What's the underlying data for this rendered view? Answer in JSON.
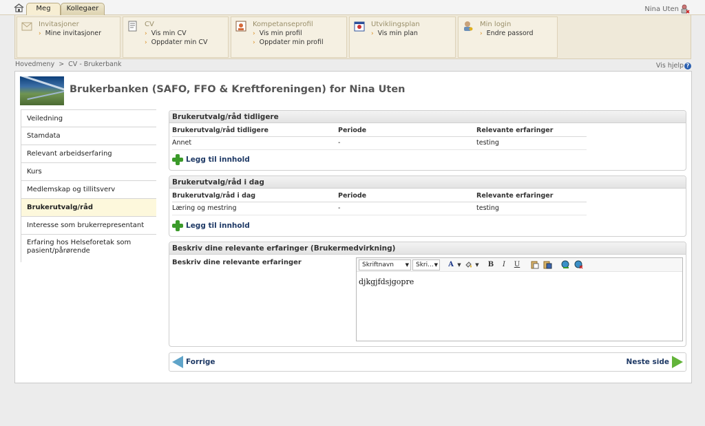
{
  "topbar": {
    "tabs": [
      {
        "label": "Meg"
      },
      {
        "label": "Kollegaer"
      }
    ],
    "user_name": "Nina Uten"
  },
  "menu": {
    "groups": [
      {
        "title": "Invitasjoner",
        "icon": "invitation-icon",
        "links": [
          "Mine invitasjoner"
        ]
      },
      {
        "title": "CV",
        "icon": "cv-document-icon",
        "links": [
          "Vis min CV",
          "Oppdater min CV"
        ]
      },
      {
        "title": "Kompetanseprofil",
        "icon": "profile-card-icon",
        "links": [
          "Vis min profil",
          "Oppdater min profil"
        ]
      },
      {
        "title": "Utviklingsplan",
        "icon": "plan-calendar-icon",
        "links": [
          "Vis min plan"
        ]
      },
      {
        "title": "Min login",
        "icon": "user-key-icon",
        "links": [
          "Endre passord"
        ]
      }
    ]
  },
  "breadcrumb": {
    "items": [
      "Hovedmeny",
      "CV - Brukerbank"
    ],
    "separator": ">"
  },
  "help": {
    "label": "Vis hjelp",
    "icon": "help-icon"
  },
  "page": {
    "title": "Brukerbanken (SAFO, FFO & Kreftforeningen) for Nina Uten"
  },
  "sidebar": {
    "items": [
      {
        "label": "Veiledning"
      },
      {
        "label": "Stamdata"
      },
      {
        "label": "Relevant arbeidserfaring"
      },
      {
        "label": "Kurs"
      },
      {
        "label": "Medlemskap og tillitsverv"
      },
      {
        "label": "Brukerutvalg/råd"
      },
      {
        "label": "Interesse som brukerrepresentant"
      },
      {
        "label": "Erfaring hos Helseforetak som pasient/pårørende"
      }
    ],
    "active_index": 5
  },
  "sections": {
    "earlier": {
      "heading": "Brukerutvalg/råd tidligere",
      "columns": [
        "Brukerutvalg/råd tidligere",
        "Periode",
        "Relevante erfaringer"
      ],
      "rows": [
        [
          "Annet",
          "-",
          "testing"
        ]
      ],
      "add_label": "Legg til innhold"
    },
    "today": {
      "heading": "Brukerutvalg/råd i dag",
      "columns": [
        "Brukerutvalg/råd i dag",
        "Periode",
        "Relevante erfaringer"
      ],
      "rows": [
        [
          "Læring og mestring",
          "-",
          "testing"
        ]
      ],
      "add_label": "Legg til innhold"
    },
    "describe": {
      "heading": "Beskriv dine relevante erfaringer (Brukermedvirkning)",
      "label": "Beskriv dine relevante erfaringer",
      "toolbar": {
        "font_name": "Skriftnavn",
        "font_size": "Skri..."
      },
      "content": "djkgjfdsjgopre"
    }
  },
  "nav": {
    "prev_label": "Forrige",
    "next_label": "Neste side"
  },
  "colors": {
    "accent_green": "#3b9a2a",
    "link_navy": "#1f3a66",
    "active_bg": "#fdf8dc"
  }
}
